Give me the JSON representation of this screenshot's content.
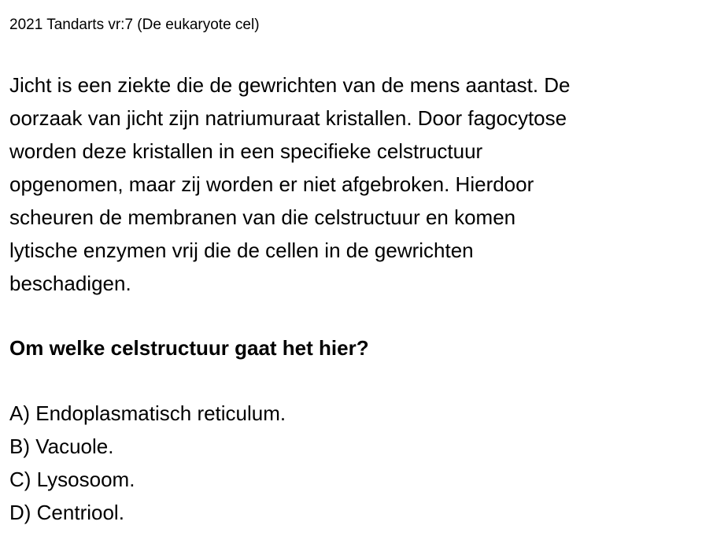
{
  "header": "2021 Tandarts vr:7 (De eukaryote cel)",
  "passage": [
    "Jicht is een ziekte die de gewrichten van de mens aantast. De",
    "oorzaak van jicht zijn natriumuraat kristallen. Door fagocytose",
    "worden deze kristallen in een specifieke celstructuur",
    "opgenomen, maar zij worden er niet afgebroken. Hierdoor",
    "scheuren de membranen van die celstructuur en komen",
    "lytische enzymen vrij die de cellen in de gewrichten",
    "beschadigen."
  ],
  "question": "Om welke celstructuur gaat het hier?",
  "options": [
    "A) Endoplasmatisch reticulum.",
    "B) Vacuole.",
    "C) Lysosoom.",
    "D) Centriool."
  ]
}
